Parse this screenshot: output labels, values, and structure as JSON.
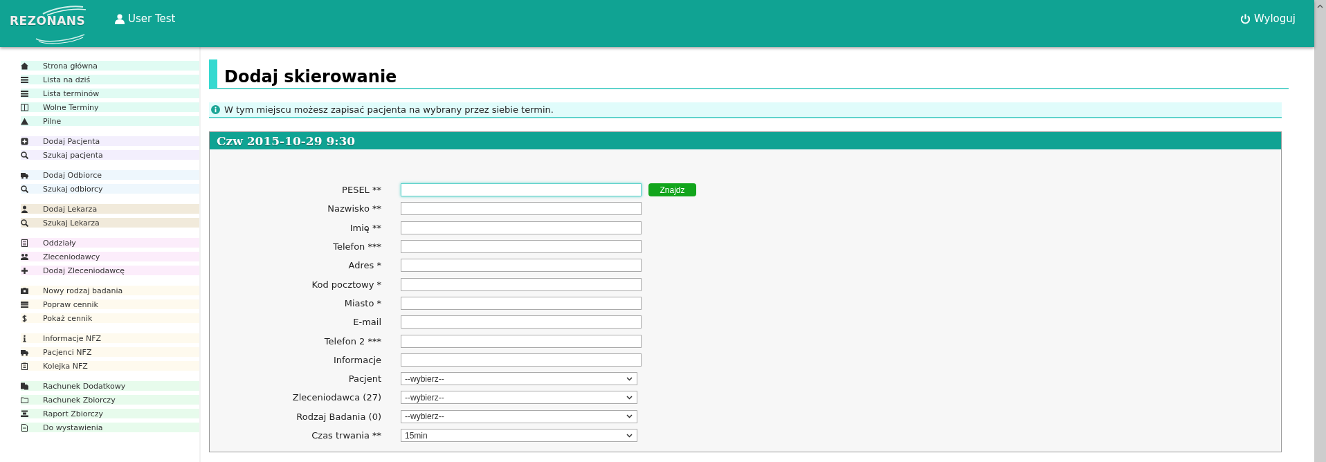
{
  "header": {
    "logo": "REZONANS",
    "user": "User Test",
    "logout": "Wyloguj"
  },
  "sidebar": {
    "groups": [
      {
        "color": "#e0fbf3",
        "items": [
          "Strona główna",
          "Lista na dziś",
          "Lista terminów",
          "Wolne Terminy",
          "Pilne"
        ]
      },
      {
        "color": "#f3effd",
        "items": [
          "Dodaj Pacjenta",
          "Szukaj pacjenta"
        ]
      },
      {
        "color": "#eef7fd",
        "items": [
          "Dodaj Odbiorce",
          "Szukaj odbiorcy"
        ]
      },
      {
        "color": "#f1eadb",
        "items": [
          "Dodaj Lekarza",
          "Szukaj Lekarza"
        ]
      },
      {
        "color": "#fcedfb",
        "items": [
          "Oddziały",
          "Zleceniodawcy",
          "Dodaj Zleceniodawcę"
        ]
      },
      {
        "color": "#fefaee",
        "items": [
          "Nowy rodzaj badania",
          "Popraw cennik",
          "Pokaż cennik"
        ]
      },
      {
        "color": "#fefaee",
        "items": [
          "Informacje NFZ",
          "Pacjenci NFZ",
          "Kolejka NFZ"
        ]
      },
      {
        "color": "#e7fbec",
        "items": [
          "Rachunek Dodatkowy",
          "Rachunek Zbiorczy",
          "Raport Zbiorczy",
          "Do wystawienia"
        ]
      }
    ]
  },
  "page": {
    "title": "Dodaj skierowanie",
    "info": "W tym miejscu możesz zapisać pacjenta na wybrany przez siebie termin."
  },
  "panel": {
    "title": "Czw 2015-10-29 9:30",
    "fields": [
      {
        "kind": "text",
        "label": "PESEL **",
        "focused": true,
        "button": "Znajdz"
      },
      {
        "kind": "text",
        "label": "Nazwisko **",
        "focused": false
      },
      {
        "kind": "text",
        "label": "Imię **",
        "focused": false
      },
      {
        "kind": "text",
        "label": "Telefon ***",
        "focused": false
      },
      {
        "kind": "text",
        "label": "Adres *",
        "focused": false
      },
      {
        "kind": "text",
        "label": "Kod pocztowy *",
        "focused": false
      },
      {
        "kind": "text",
        "label": "Miasto *",
        "focused": false
      },
      {
        "kind": "text",
        "label": "E-mail",
        "focused": false
      },
      {
        "kind": "text",
        "label": "Telefon 2 ***",
        "focused": false
      },
      {
        "kind": "text",
        "label": "Informacje",
        "focused": false
      },
      {
        "kind": "select",
        "label": "Pacjent",
        "value": "--wybierz--"
      },
      {
        "kind": "select",
        "label": "Zleceniodawca (27)",
        "value": "--wybierz--"
      },
      {
        "kind": "select",
        "label": "Rodzaj Badania (0)",
        "value": "--wybierz--"
      },
      {
        "kind": "select",
        "label": "Czas trwania **",
        "value": "15min"
      }
    ]
  }
}
